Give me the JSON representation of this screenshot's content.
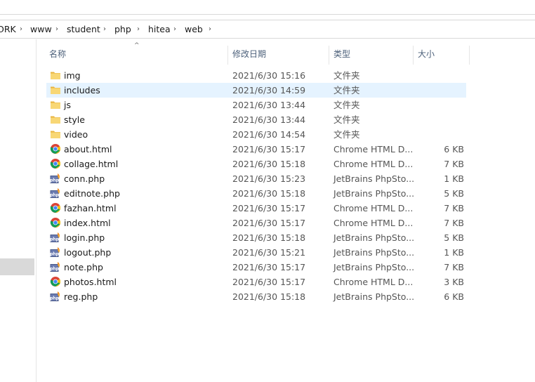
{
  "breadcrumb": [
    "ORK",
    "www",
    "student",
    "php",
    "hitea",
    "web"
  ],
  "columns": {
    "name": "名称",
    "date": "修改日期",
    "type": "类型",
    "size": "大小"
  },
  "files": [
    {
      "name": "img",
      "date": "2021/6/30 15:16",
      "type": "文件夹",
      "size": "",
      "icon": "folder-icon"
    },
    {
      "name": "includes",
      "date": "2021/6/30 14:59",
      "type": "文件夹",
      "size": "",
      "icon": "folder-icon"
    },
    {
      "name": "js",
      "date": "2021/6/30 13:44",
      "type": "文件夹",
      "size": "",
      "icon": "folder-icon"
    },
    {
      "name": "style",
      "date": "2021/6/30 13:44",
      "type": "文件夹",
      "size": "",
      "icon": "folder-icon"
    },
    {
      "name": "video",
      "date": "2021/6/30 14:54",
      "type": "文件夹",
      "size": "",
      "icon": "folder-icon"
    },
    {
      "name": "about.html",
      "date": "2021/6/30 15:17",
      "type": "Chrome HTML D...",
      "size": "6 KB",
      "icon": "chrome-icon"
    },
    {
      "name": "collage.html",
      "date": "2021/6/30 15:18",
      "type": "Chrome HTML D...",
      "size": "7 KB",
      "icon": "chrome-icon"
    },
    {
      "name": "conn.php",
      "date": "2021/6/30 15:23",
      "type": "JetBrains PhpSto...",
      "size": "1 KB",
      "icon": "php-icon"
    },
    {
      "name": "editnote.php",
      "date": "2021/6/30 15:18",
      "type": "JetBrains PhpSto...",
      "size": "5 KB",
      "icon": "php-icon"
    },
    {
      "name": "fazhan.html",
      "date": "2021/6/30 15:17",
      "type": "Chrome HTML D...",
      "size": "7 KB",
      "icon": "chrome-icon"
    },
    {
      "name": "index.html",
      "date": "2021/6/30 15:17",
      "type": "Chrome HTML D...",
      "size": "7 KB",
      "icon": "chrome-icon"
    },
    {
      "name": "login.php",
      "date": "2021/6/30 15:18",
      "type": "JetBrains PhpSto...",
      "size": "5 KB",
      "icon": "php-icon"
    },
    {
      "name": "logout.php",
      "date": "2021/6/30 15:21",
      "type": "JetBrains PhpSto...",
      "size": "1 KB",
      "icon": "php-icon"
    },
    {
      "name": "note.php",
      "date": "2021/6/30 15:17",
      "type": "JetBrains PhpSto...",
      "size": "7 KB",
      "icon": "php-icon"
    },
    {
      "name": "photos.html",
      "date": "2021/6/30 15:17",
      "type": "Chrome HTML D...",
      "size": "3 KB",
      "icon": "chrome-icon"
    },
    {
      "name": "reg.php",
      "date": "2021/6/30 15:18",
      "type": "JetBrains PhpSto...",
      "size": "6 KB",
      "icon": "php-icon"
    }
  ],
  "selected_row": "includes",
  "colors": {
    "selection": "#e5f3ff",
    "folder": "#f8d775",
    "header_text": "#4c607a"
  },
  "sort_indicator": "chevron-up-icon"
}
